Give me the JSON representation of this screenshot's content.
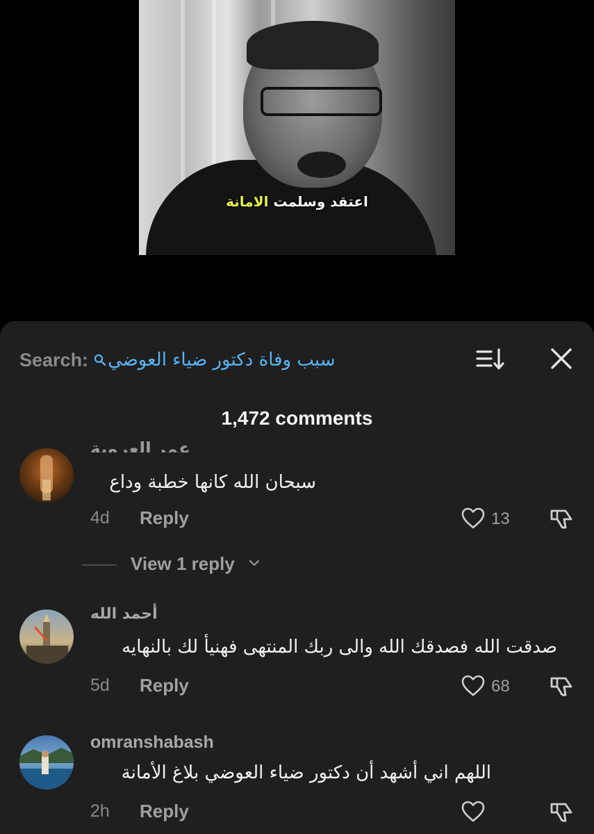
{
  "video": {
    "subtitle_white": "اعتقد وسلمت",
    "subtitle_green": "الامانة"
  },
  "sheet": {
    "search_label": "Search:",
    "search_query": "سبب وفاة دكتور ضياء العوضي",
    "comment_count": "1,472 comments",
    "view_replies_label": "View 1 reply"
  },
  "comments": [
    {
      "username": "عمر العروبة",
      "text": "سبحان الله كانها خطبة وداع",
      "time": "4d",
      "reply_label": "Reply",
      "likes": "13"
    },
    {
      "username": "أحمد الله",
      "text": "صدقت الله فصدقك الله والى ربك المنتهى فهنيأ لك بالنهايه",
      "time": "5d",
      "reply_label": "Reply",
      "likes": "68"
    },
    {
      "username": "omranshabash",
      "text": "اللهم اني أشهد أن دكتور ضياء العوضي بلاغ الأمانة",
      "time": "2h",
      "reply_label": "Reply",
      "likes": ""
    }
  ],
  "colors": {
    "background": "#000000",
    "sheet": "#1f1f1f",
    "link": "#5ab4f5",
    "subtitle_highlight": "#e6f24a",
    "muted": "#a0a0a0"
  },
  "icons": [
    "search-icon",
    "sort-icon",
    "close-icon",
    "heart-icon",
    "dislike-icon",
    "chevron-down-icon"
  ]
}
